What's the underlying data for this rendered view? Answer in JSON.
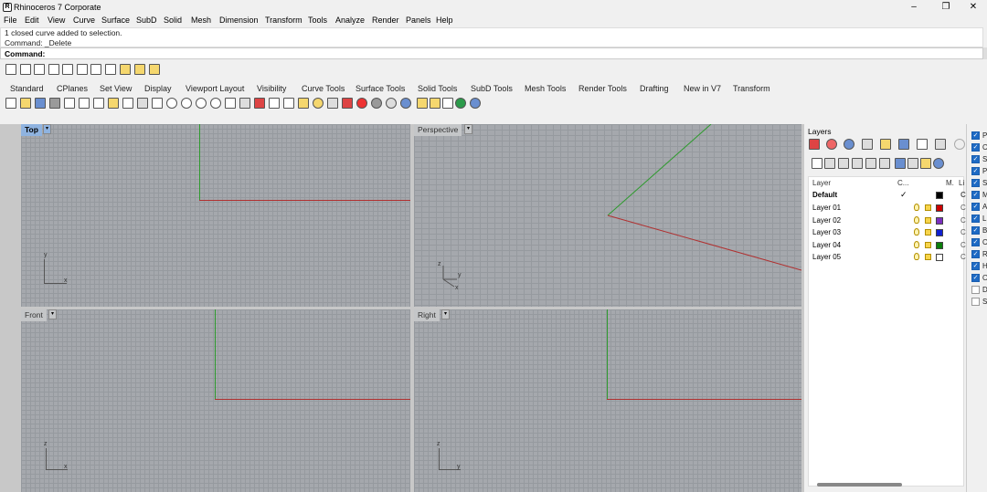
{
  "window": {
    "title": "Rhinoceros 7 Corporate",
    "app_icon": "rhino-icon",
    "minimize": "–",
    "maximize": "❐",
    "close": "✕"
  },
  "menu": [
    "File",
    "Edit",
    "View",
    "Curve",
    "Surface",
    "SubD",
    "Solid",
    "Mesh",
    "Dimension",
    "Transform",
    "Tools",
    "Analyze",
    "Render",
    "Panels",
    "Help"
  ],
  "command_history": [
    "1 closed curve added to selection.",
    "Command: _Delete"
  ],
  "command_prompt": "Command:",
  "toolbar_tabs": [
    "Standard",
    "CPlanes",
    "Set View",
    "Display",
    "Viewport Layout",
    "Visibility",
    "Curve Tools",
    "Surface Tools",
    "Solid Tools",
    "SubD Tools",
    "Mesh Tools",
    "Render Tools",
    "Drafting",
    "New in V7",
    "Transform"
  ],
  "viewports": [
    {
      "name": "Top",
      "active": true,
      "axes": [
        "y",
        "x"
      ]
    },
    {
      "name": "Perspective",
      "active": false,
      "axes": [
        "z",
        "y",
        "x"
      ]
    },
    {
      "name": "Front",
      "active": false,
      "axes": [
        "z",
        "x"
      ]
    },
    {
      "name": "Right",
      "active": false,
      "axes": [
        "z",
        "y"
      ]
    }
  ],
  "dropdown_glyph": "▾",
  "colors": {
    "x_axis": "#b03030",
    "y_axis": "#2e9a2e",
    "grid": "#a5a8ad",
    "active_label": "#8fb3e0"
  },
  "layers_panel": {
    "title": "Layers",
    "columns": {
      "layer": "Layer",
      "current": "C...",
      "material": "M.",
      "linetype": "Li"
    },
    "rows": [
      {
        "name": "Default",
        "current": true,
        "color": "#000000",
        "material": "C",
        "bold": true
      },
      {
        "name": "Layer 01",
        "current": false,
        "color": "#cc0000",
        "material": "C"
      },
      {
        "name": "Layer 02",
        "current": false,
        "color": "#7b2fbf",
        "material": "C"
      },
      {
        "name": "Layer 03",
        "current": false,
        "color": "#1020d0",
        "material": "C"
      },
      {
        "name": "Layer 04",
        "current": false,
        "color": "#0a7d0a",
        "material": "C"
      },
      {
        "name": "Layer 05",
        "current": false,
        "color": "#ffffff",
        "material": "C"
      }
    ],
    "checkmark": "✓"
  },
  "props_panel": {
    "items": [
      {
        "label": "P",
        "checked": true
      },
      {
        "label": "C",
        "checked": true
      },
      {
        "label": "S",
        "checked": true
      },
      {
        "label": "P",
        "checked": true
      },
      {
        "label": "S",
        "checked": true
      },
      {
        "label": "M",
        "checked": true
      },
      {
        "label": "A",
        "checked": true
      },
      {
        "label": "Li",
        "checked": true
      },
      {
        "label": "B",
        "checked": true
      },
      {
        "label": "C",
        "checked": true
      },
      {
        "label": "R",
        "checked": true
      },
      {
        "label": "H",
        "checked": true
      },
      {
        "label": "O",
        "checked": true
      },
      {
        "label": "D",
        "checked": false
      },
      {
        "label": "S",
        "checked": false
      }
    ]
  },
  "left_tools_overflow": "»"
}
